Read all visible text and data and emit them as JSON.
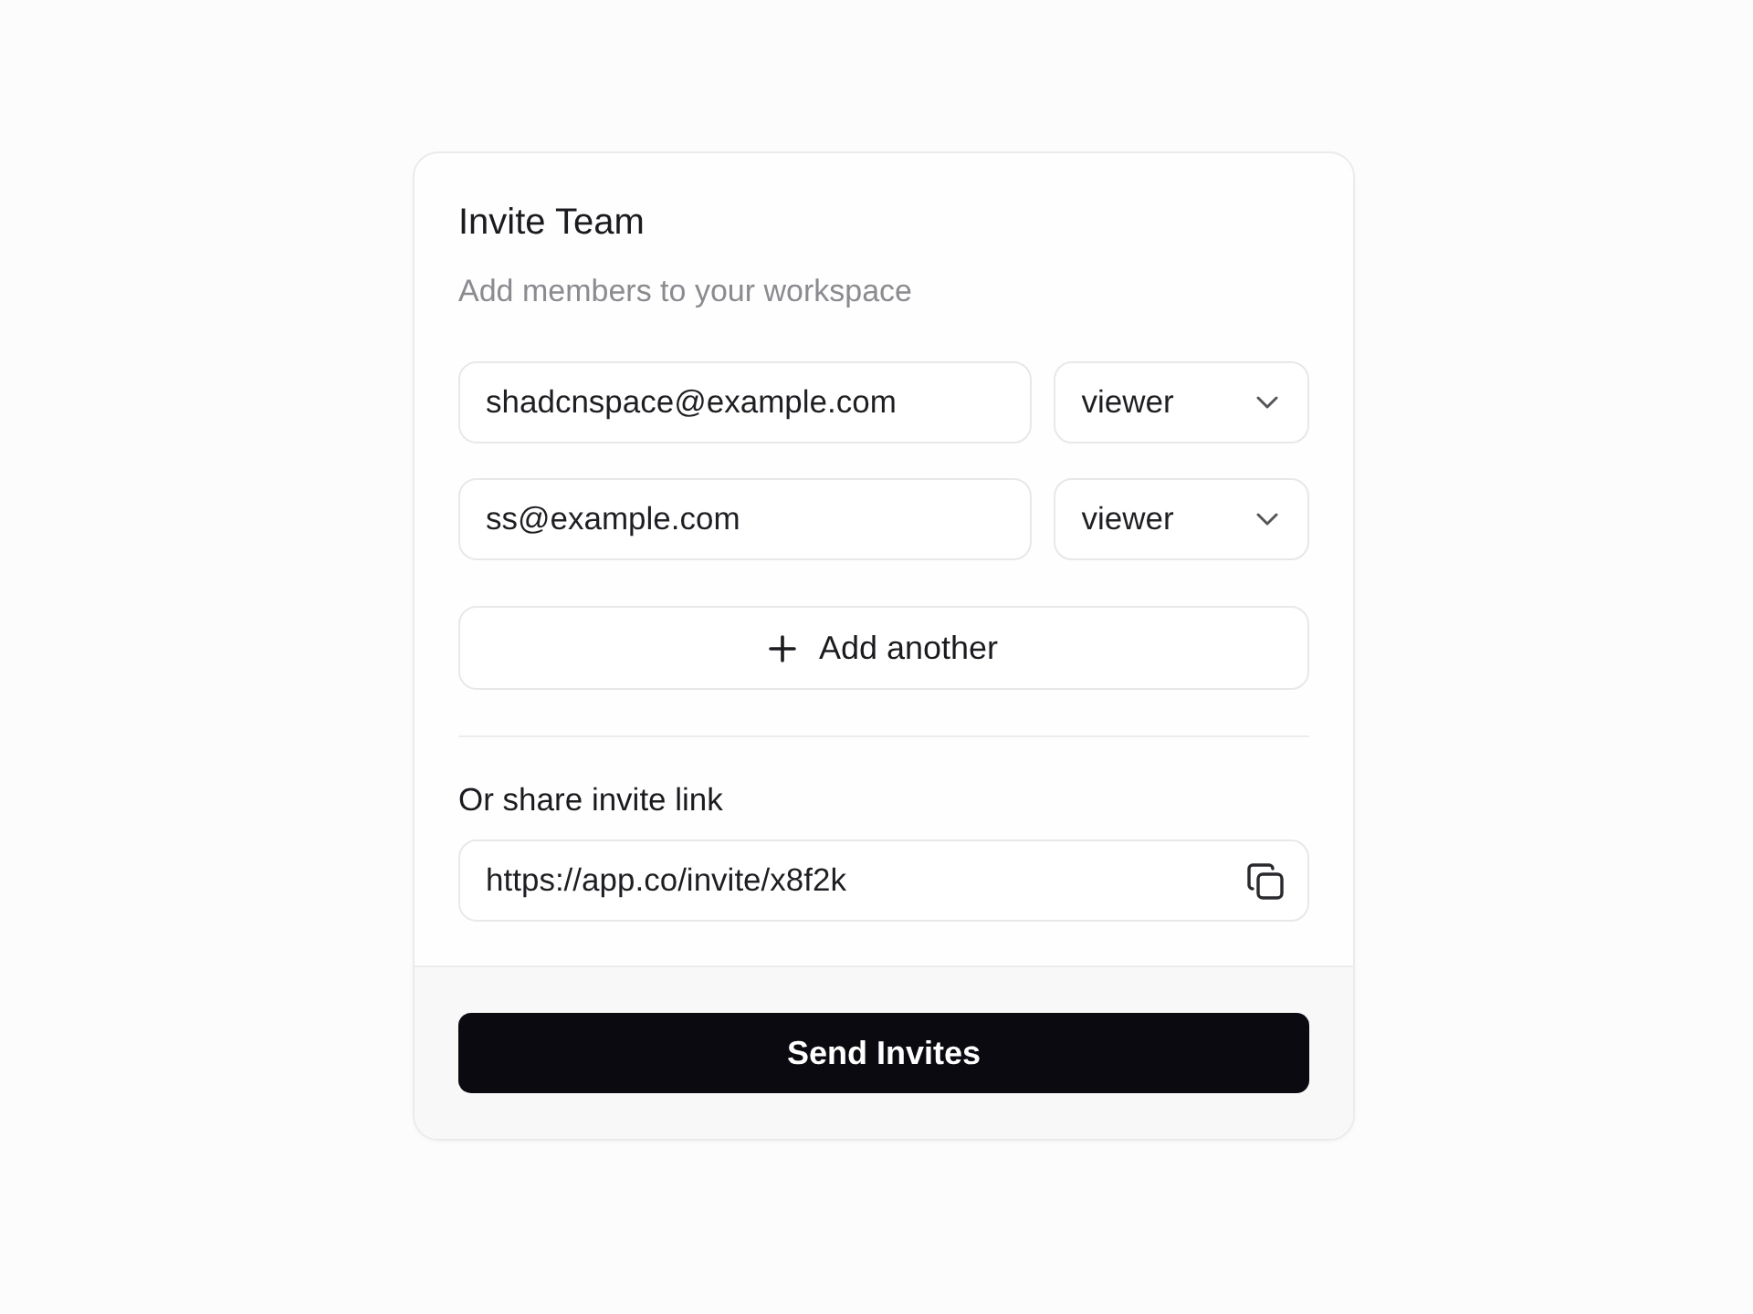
{
  "card": {
    "title": "Invite Team",
    "subtitle": "Add members to your workspace"
  },
  "invites": [
    {
      "email": "shadcnspace@example.com",
      "role": "viewer"
    },
    {
      "email": "ss@example.com",
      "role": "viewer"
    }
  ],
  "add_button": {
    "label": "Add another"
  },
  "share": {
    "label": "Or share invite link",
    "link": "https://app.co/invite/x8f2k"
  },
  "submit_button": {
    "label": "Send Invites"
  }
}
